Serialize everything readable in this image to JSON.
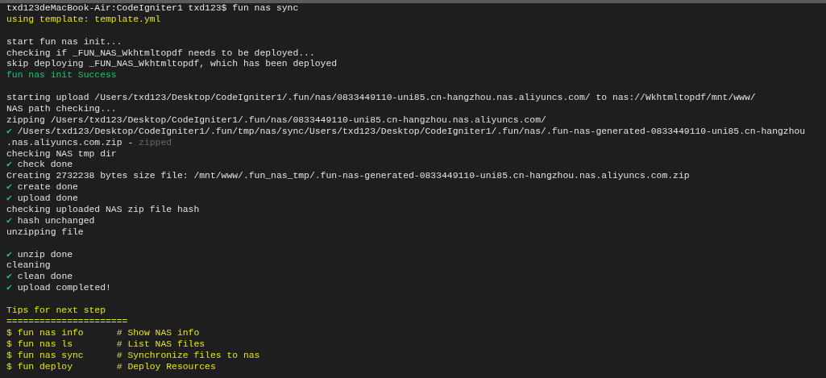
{
  "lines": [
    {
      "segments": [
        {
          "text": "txd123deMacBook-Air:CodeIgniter1 txd123$ fun nas sync",
          "kind": "prompt"
        }
      ]
    },
    {
      "segments": [
        {
          "text": "using template: template.yml",
          "kind": "yellow"
        }
      ]
    },
    {
      "kind": "blank"
    },
    {
      "segments": [
        {
          "text": "start fun nas init...",
          "kind": "plain"
        }
      ]
    },
    {
      "segments": [
        {
          "text": "checking if _FUN_NAS_Wkhtmltopdf needs to be deployed...",
          "kind": "plain"
        }
      ]
    },
    {
      "segments": [
        {
          "text": "skip deploying _FUN_NAS_Wkhtmltopdf, which has been deployed",
          "kind": "plain"
        }
      ]
    },
    {
      "segments": [
        {
          "text": "fun nas init Success",
          "kind": "green"
        }
      ]
    },
    {
      "kind": "blank"
    },
    {
      "segments": [
        {
          "text": "starting upload /Users/txd123/Desktop/CodeIgniter1/.fun/nas/0833449110-uni85.cn-hangzhou.nas.aliyuncs.com/ to nas://Wkhtmltopdf/mnt/www/",
          "kind": "plain"
        }
      ]
    },
    {
      "segments": [
        {
          "text": "NAS path checking...",
          "kind": "plain"
        }
      ]
    },
    {
      "segments": [
        {
          "text": "zipping /Users/txd123/Desktop/CodeIgniter1/.fun/nas/0833449110-uni85.cn-hangzhou.nas.aliyuncs.com/",
          "kind": "plain"
        }
      ]
    },
    {
      "segments": [
        {
          "text": "✔",
          "kind": "check"
        },
        {
          "text": " /Users/txd123/Desktop/CodeIgniter1/.fun/tmp/nas/sync/Users/txd123/Desktop/CodeIgniter1/.fun/nas/.fun-nas-generated-0833449110-uni85.cn-hangzhou",
          "kind": "plain"
        }
      ]
    },
    {
      "segments": [
        {
          "text": ".nas.aliyuncs.com.zip - ",
          "kind": "plain"
        },
        {
          "text": "zipped",
          "kind": "dim"
        }
      ]
    },
    {
      "segments": [
        {
          "text": "checking NAS tmp dir",
          "kind": "plain"
        }
      ]
    },
    {
      "segments": [
        {
          "text": "✔",
          "kind": "check"
        },
        {
          "text": " check done",
          "kind": "plain"
        }
      ]
    },
    {
      "segments": [
        {
          "text": "Creating 2732238 bytes size file: /mnt/www/.fun_nas_tmp/.fun-nas-generated-0833449110-uni85.cn-hangzhou.nas.aliyuncs.com.zip",
          "kind": "plain"
        }
      ]
    },
    {
      "segments": [
        {
          "text": "✔",
          "kind": "check"
        },
        {
          "text": " create done",
          "kind": "plain"
        }
      ]
    },
    {
      "segments": [
        {
          "text": "✔",
          "kind": "check"
        },
        {
          "text": " upload done",
          "kind": "plain"
        }
      ]
    },
    {
      "segments": [
        {
          "text": "checking uploaded NAS zip file hash",
          "kind": "plain"
        }
      ]
    },
    {
      "segments": [
        {
          "text": "✔",
          "kind": "check"
        },
        {
          "text": " hash unchanged",
          "kind": "plain"
        }
      ]
    },
    {
      "segments": [
        {
          "text": "unzipping file",
          "kind": "plain"
        }
      ]
    },
    {
      "kind": "blank"
    },
    {
      "segments": [
        {
          "text": "✔",
          "kind": "check"
        },
        {
          "text": " unzip done",
          "kind": "plain"
        }
      ]
    },
    {
      "segments": [
        {
          "text": "cleaning",
          "kind": "plain"
        }
      ]
    },
    {
      "segments": [
        {
          "text": "✔",
          "kind": "check"
        },
        {
          "text": " clean done",
          "kind": "plain"
        }
      ]
    },
    {
      "segments": [
        {
          "text": "✔",
          "kind": "check"
        },
        {
          "text": " upload completed!",
          "kind": "plain"
        }
      ]
    },
    {
      "kind": "blank"
    },
    {
      "segments": [
        {
          "text": "Tips for next step",
          "kind": "yellow"
        }
      ]
    },
    {
      "segments": [
        {
          "text": "======================",
          "kind": "yellow"
        }
      ]
    },
    {
      "segments": [
        {
          "text": "$ fun nas info      # Show NAS info",
          "kind": "yellow"
        }
      ]
    },
    {
      "segments": [
        {
          "text": "$ fun nas ls        # List NAS files",
          "kind": "yellow"
        }
      ]
    },
    {
      "segments": [
        {
          "text": "$ fun nas sync      # Synchronize files to nas",
          "kind": "yellow"
        }
      ]
    },
    {
      "segments": [
        {
          "text": "$ fun deploy        # Deploy Resources",
          "kind": "yellow"
        }
      ]
    }
  ]
}
